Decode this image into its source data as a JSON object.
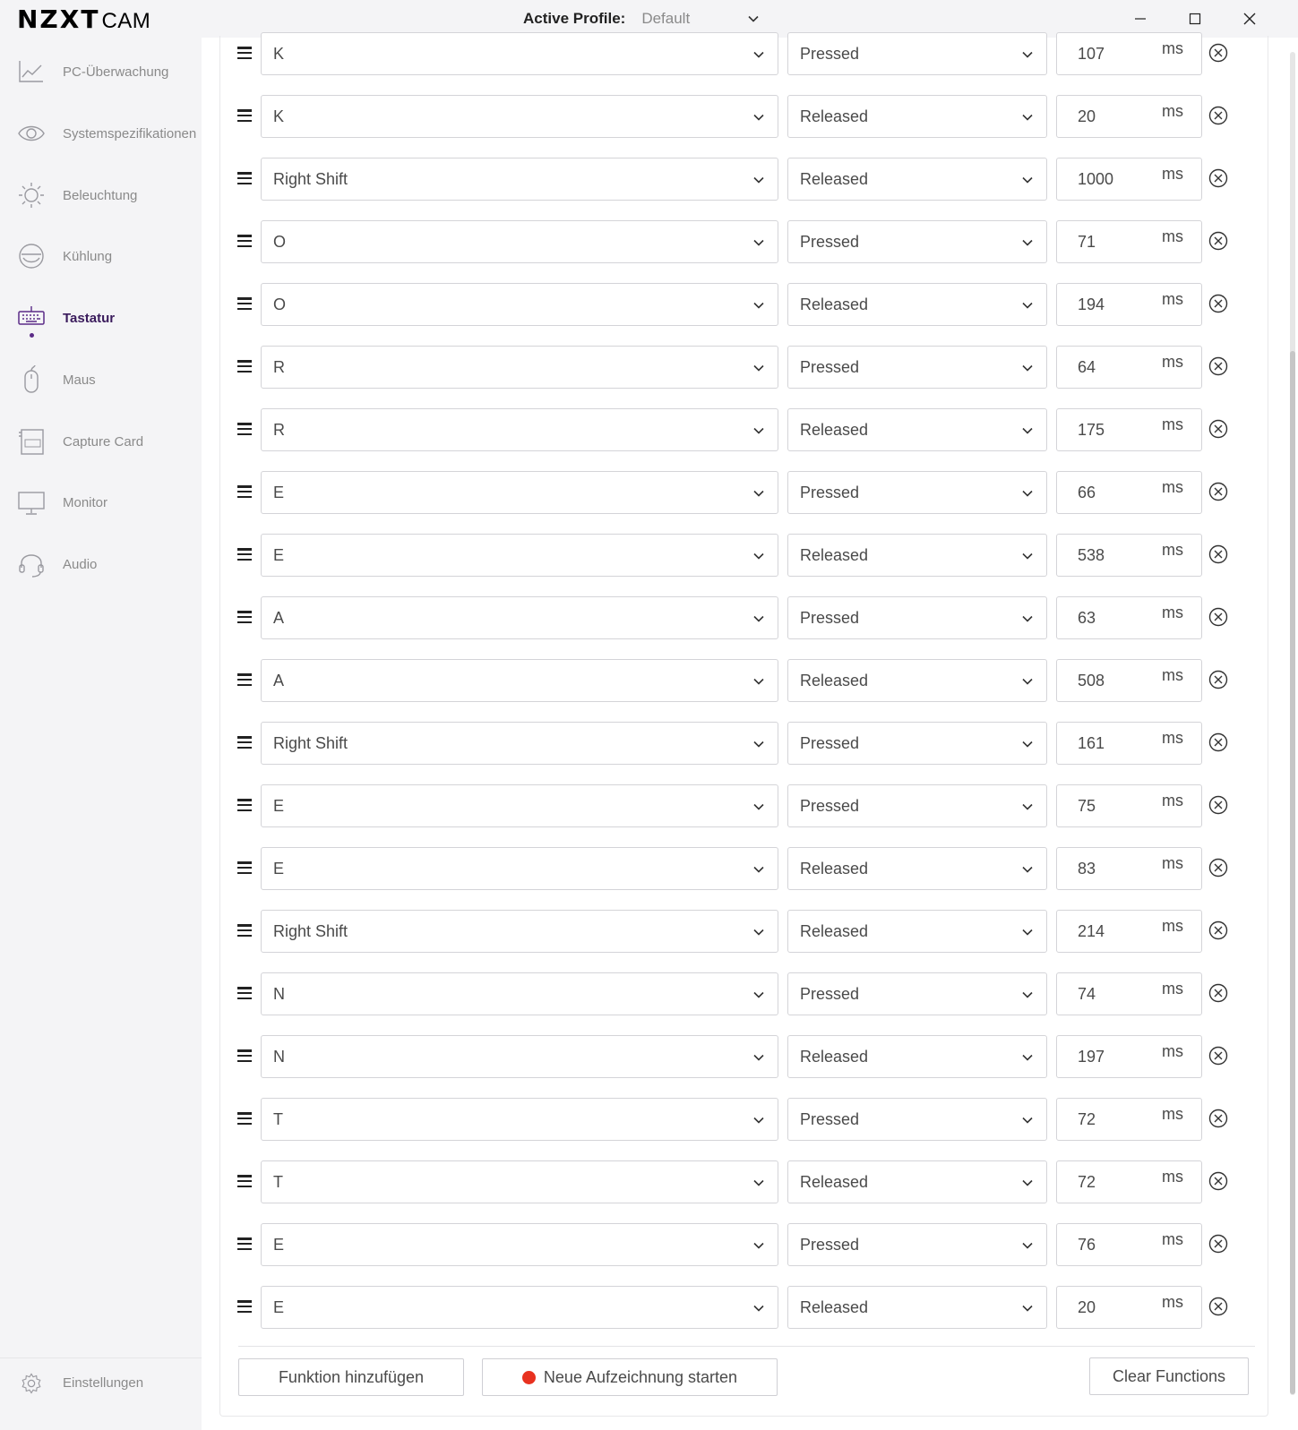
{
  "app": {
    "logo_bold": "NZXT",
    "logo_light": "CAM"
  },
  "header": {
    "profile_label": "Active Profile:",
    "profile_value": "Default"
  },
  "sidebar": {
    "items": [
      {
        "label": "PC-Überwachung",
        "icon": "chart-line-icon",
        "active": false
      },
      {
        "label": "Systemspezifikationen",
        "icon": "eye-icon",
        "active": false
      },
      {
        "label": "Beleuchtung",
        "icon": "sun-icon",
        "active": false
      },
      {
        "label": "Kühlung",
        "icon": "cooler-icon",
        "active": false
      },
      {
        "label": "Tastatur",
        "icon": "keyboard-icon",
        "active": true
      },
      {
        "label": "Maus",
        "icon": "mouse-icon",
        "active": false
      },
      {
        "label": "Capture Card",
        "icon": "capture-card-icon",
        "active": false
      },
      {
        "label": "Monitor",
        "icon": "monitor-icon",
        "active": false
      },
      {
        "label": "Audio",
        "icon": "headset-icon",
        "active": false
      }
    ],
    "settings_label": "Einstellungen"
  },
  "macro": {
    "unit": "ms",
    "rows": [
      {
        "key": "K",
        "state": "Pressed",
        "delay": "107"
      },
      {
        "key": "K",
        "state": "Released",
        "delay": "20"
      },
      {
        "key": "Right Shift",
        "state": "Released",
        "delay": "1000"
      },
      {
        "key": "O",
        "state": "Pressed",
        "delay": "71"
      },
      {
        "key": "O",
        "state": "Released",
        "delay": "194"
      },
      {
        "key": "R",
        "state": "Pressed",
        "delay": "64"
      },
      {
        "key": "R",
        "state": "Released",
        "delay": "175"
      },
      {
        "key": "E",
        "state": "Pressed",
        "delay": "66"
      },
      {
        "key": "E",
        "state": "Released",
        "delay": "538"
      },
      {
        "key": "A",
        "state": "Pressed",
        "delay": "63"
      },
      {
        "key": "A",
        "state": "Released",
        "delay": "508"
      },
      {
        "key": "Right Shift",
        "state": "Pressed",
        "delay": "161"
      },
      {
        "key": "E",
        "state": "Pressed",
        "delay": "75"
      },
      {
        "key": "E",
        "state": "Released",
        "delay": "83"
      },
      {
        "key": "Right Shift",
        "state": "Released",
        "delay": "214"
      },
      {
        "key": "N",
        "state": "Pressed",
        "delay": "74"
      },
      {
        "key": "N",
        "state": "Released",
        "delay": "197"
      },
      {
        "key": "T",
        "state": "Pressed",
        "delay": "72"
      },
      {
        "key": "T",
        "state": "Released",
        "delay": "72"
      },
      {
        "key": "E",
        "state": "Pressed",
        "delay": "76"
      },
      {
        "key": "E",
        "state": "Released",
        "delay": "20"
      }
    ],
    "add_button": "Funktion hinzufügen",
    "record_button": "Neue Aufzeichnung starten",
    "clear_button": "Clear Functions"
  },
  "colors": {
    "accent": "#5b2b87",
    "record": "#e8311f",
    "sidebar_bg": "#f4f4f6"
  }
}
